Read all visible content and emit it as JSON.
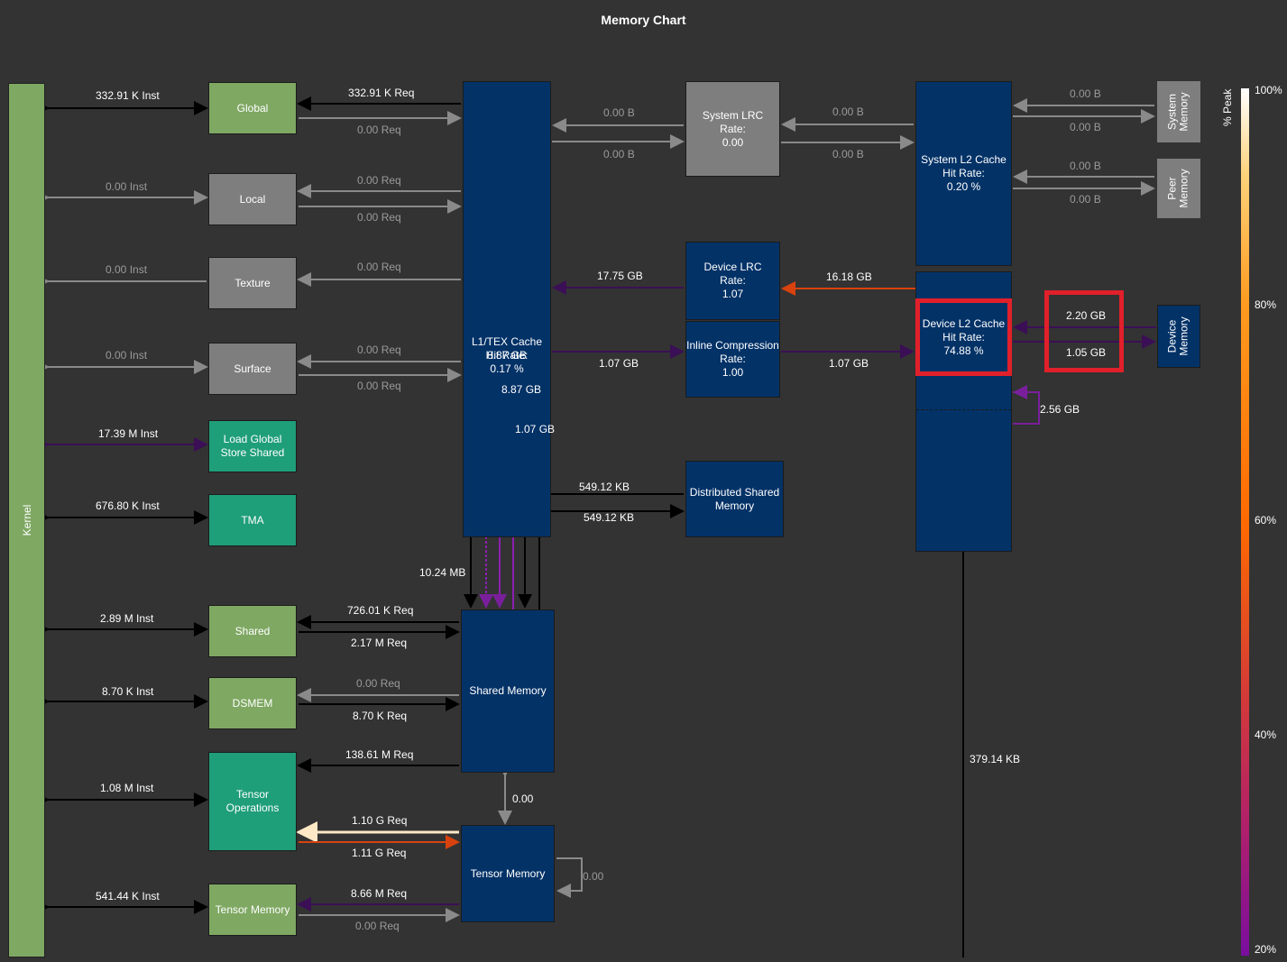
{
  "title": "Memory Chart",
  "kernel_label": "Kernel",
  "left_units": [
    {
      "name": "Global",
      "inst": "332.91 K Inst",
      "req_in": "332.91 K Req",
      "req_out": "0.00  Req"
    },
    {
      "name": "Local",
      "inst": "0.00  Inst",
      "req_in": "0.00  Req",
      "req_out": "0.00  Req"
    },
    {
      "name": "Texture",
      "inst": "0.00  Inst",
      "req_in": "0.00  Req"
    },
    {
      "name": "Surface",
      "inst": "0.00  Inst",
      "req_in": "0.00  Req",
      "req_out": "0.00  Req"
    },
    {
      "name": "Load Global\nStore Shared",
      "inst": "17.39 M Inst"
    },
    {
      "name": "TMA",
      "inst": "676.80 K Inst"
    },
    {
      "name": "Shared",
      "inst": "2.89 M Inst",
      "req_in": "726.01 K Req",
      "req_out": "2.17 M Req"
    },
    {
      "name": "DSMEM",
      "inst": "8.70 K Inst",
      "req_in": "0.00  Req",
      "req_out": "8.70 K Req"
    },
    {
      "name": "Tensor\nOperations",
      "inst": "1.08 M Inst",
      "req_in": "138.61 M Req",
      "req_in2": "1.10 G Req",
      "req_out": "1.11 G Req"
    },
    {
      "name": "Tensor Memory",
      "inst": "541.44 K Inst",
      "req_in": "8.66 M Req",
      "req_out": "0.00  Req"
    }
  ],
  "l1": {
    "name": "L1/TEX Cache",
    "hit_label": "Hit Rate:",
    "hit": "0.17 %"
  },
  "sys_lrc": {
    "name": "System LRC",
    "rate_label": "Rate:",
    "rate": "0.00",
    "left_in": "0.00 B",
    "left_out": "0.00 B",
    "right_in": "0.00 B",
    "right_out": "0.00 B"
  },
  "sys_l2": {
    "name": "System L2 Cache",
    "hit_label": "Hit Rate:",
    "hit": "0.20 %"
  },
  "system_memory": {
    "name": "System\nMemory",
    "in": "0.00 B",
    "out": "0.00 B"
  },
  "peer_memory": {
    "name": "Peer\nMemory",
    "in": "0.00 B",
    "out": "0.00 B"
  },
  "dev_lrc": {
    "name": "Device LRC",
    "rate_label": "Rate:",
    "rate": "1.07",
    "to_l1": "17.75 GB",
    "from_l2": "16.18 GB"
  },
  "inline_comp": {
    "name": "Inline Compression",
    "rate_label": "Rate:",
    "rate": "1.00",
    "from_l1": "1.07 GB",
    "to_l2": "1.07 GB"
  },
  "dev_l2": {
    "name": "Device L2 Cache",
    "hit_label": "Hit Rate:",
    "hit": "74.88 %",
    "self_loop": "2.56 GB",
    "to_shared_bottom": "379.14 KB"
  },
  "device_memory": {
    "name": "Device\nMemory",
    "read": "2.20 GB",
    "write": "1.05 GB"
  },
  "l1_to_shared": {
    "a": "8.87 GB",
    "b": "8.87 GB",
    "c": "1.07 GB",
    "d": "10.24 MB"
  },
  "dsm": {
    "name": "Distributed Shared\nMemory",
    "in": "549.12 KB",
    "out": "549.12 KB"
  },
  "shared_memory": {
    "name": "Shared Memory",
    "to_tensor": "0.00"
  },
  "tensor_memory": {
    "name": "Tensor Memory",
    "self_loop": "0.00"
  },
  "legend": {
    "title": "% Peak",
    "ticks": [
      "100%",
      "80%",
      "60%",
      "40%",
      "20%"
    ]
  },
  "colors": {
    "black_link": "#000000",
    "grey_link": "#8a8a8a",
    "purple_link": "#3b0f55",
    "orange_link": "#d8420e",
    "highlight": "#e0202a"
  }
}
